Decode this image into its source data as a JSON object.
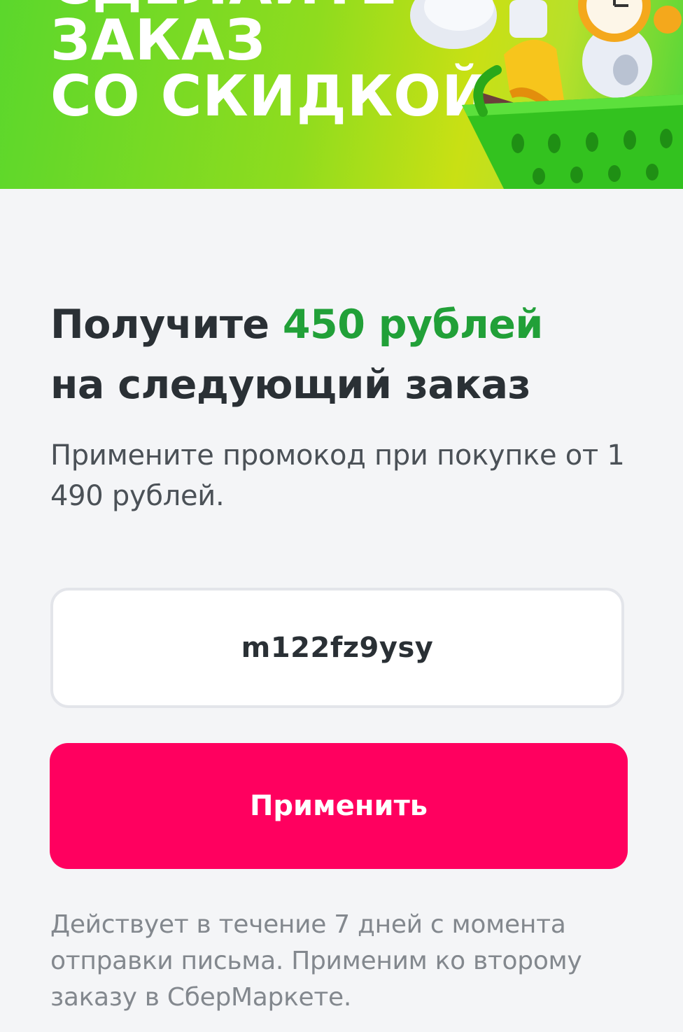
{
  "banner": {
    "line1": "СДЕЛАЙТЕ",
    "line2": "ЗАКАЗ",
    "line3": "СО СКИДКОЙ",
    "illustration": "shopping-basket-with-groceries",
    "colors": {
      "green": "#5bd72c",
      "lime": "#c9e014"
    }
  },
  "offer": {
    "headline_prefix": "Получите ",
    "headline_amount": "450 рублей",
    "headline_suffix": "на следующий заказ",
    "description": "Примените промокод при покупке от 1 490 рублей.",
    "accent_color": "#21a038"
  },
  "promo": {
    "code": "m122fz9ysy"
  },
  "actions": {
    "apply_label": "Применить",
    "apply_color": "#ff005f"
  },
  "footnote": "Действует в течение 7 дней с момента отправки письма. Применим ко второму заказу в СберМаркете."
}
